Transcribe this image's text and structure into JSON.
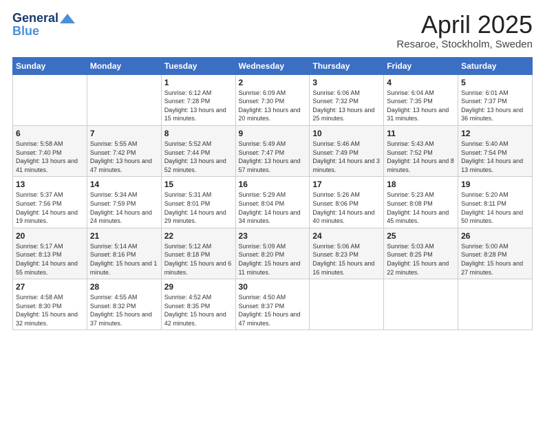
{
  "logo": {
    "general": "General",
    "blue": "Blue"
  },
  "header": {
    "title": "April 2025",
    "subtitle": "Resaroe, Stockholm, Sweden"
  },
  "weekdays": [
    "Sunday",
    "Monday",
    "Tuesday",
    "Wednesday",
    "Thursday",
    "Friday",
    "Saturday"
  ],
  "weeks": [
    [
      {
        "day": "",
        "info": ""
      },
      {
        "day": "",
        "info": ""
      },
      {
        "day": "1",
        "info": "Sunrise: 6:12 AM\nSunset: 7:28 PM\nDaylight: 13 hours and 15 minutes."
      },
      {
        "day": "2",
        "info": "Sunrise: 6:09 AM\nSunset: 7:30 PM\nDaylight: 13 hours and 20 minutes."
      },
      {
        "day": "3",
        "info": "Sunrise: 6:06 AM\nSunset: 7:32 PM\nDaylight: 13 hours and 25 minutes."
      },
      {
        "day": "4",
        "info": "Sunrise: 6:04 AM\nSunset: 7:35 PM\nDaylight: 13 hours and 31 minutes."
      },
      {
        "day": "5",
        "info": "Sunrise: 6:01 AM\nSunset: 7:37 PM\nDaylight: 13 hours and 36 minutes."
      }
    ],
    [
      {
        "day": "6",
        "info": "Sunrise: 5:58 AM\nSunset: 7:40 PM\nDaylight: 13 hours and 41 minutes."
      },
      {
        "day": "7",
        "info": "Sunrise: 5:55 AM\nSunset: 7:42 PM\nDaylight: 13 hours and 47 minutes."
      },
      {
        "day": "8",
        "info": "Sunrise: 5:52 AM\nSunset: 7:44 PM\nDaylight: 13 hours and 52 minutes."
      },
      {
        "day": "9",
        "info": "Sunrise: 5:49 AM\nSunset: 7:47 PM\nDaylight: 13 hours and 57 minutes."
      },
      {
        "day": "10",
        "info": "Sunrise: 5:46 AM\nSunset: 7:49 PM\nDaylight: 14 hours and 3 minutes."
      },
      {
        "day": "11",
        "info": "Sunrise: 5:43 AM\nSunset: 7:52 PM\nDaylight: 14 hours and 8 minutes."
      },
      {
        "day": "12",
        "info": "Sunrise: 5:40 AM\nSunset: 7:54 PM\nDaylight: 14 hours and 13 minutes."
      }
    ],
    [
      {
        "day": "13",
        "info": "Sunrise: 5:37 AM\nSunset: 7:56 PM\nDaylight: 14 hours and 19 minutes."
      },
      {
        "day": "14",
        "info": "Sunrise: 5:34 AM\nSunset: 7:59 PM\nDaylight: 14 hours and 24 minutes."
      },
      {
        "day": "15",
        "info": "Sunrise: 5:31 AM\nSunset: 8:01 PM\nDaylight: 14 hours and 29 minutes."
      },
      {
        "day": "16",
        "info": "Sunrise: 5:29 AM\nSunset: 8:04 PM\nDaylight: 14 hours and 34 minutes."
      },
      {
        "day": "17",
        "info": "Sunrise: 5:26 AM\nSunset: 8:06 PM\nDaylight: 14 hours and 40 minutes."
      },
      {
        "day": "18",
        "info": "Sunrise: 5:23 AM\nSunset: 8:08 PM\nDaylight: 14 hours and 45 minutes."
      },
      {
        "day": "19",
        "info": "Sunrise: 5:20 AM\nSunset: 8:11 PM\nDaylight: 14 hours and 50 minutes."
      }
    ],
    [
      {
        "day": "20",
        "info": "Sunrise: 5:17 AM\nSunset: 8:13 PM\nDaylight: 14 hours and 55 minutes."
      },
      {
        "day": "21",
        "info": "Sunrise: 5:14 AM\nSunset: 8:16 PM\nDaylight: 15 hours and 1 minute."
      },
      {
        "day": "22",
        "info": "Sunrise: 5:12 AM\nSunset: 8:18 PM\nDaylight: 15 hours and 6 minutes."
      },
      {
        "day": "23",
        "info": "Sunrise: 5:09 AM\nSunset: 8:20 PM\nDaylight: 15 hours and 11 minutes."
      },
      {
        "day": "24",
        "info": "Sunrise: 5:06 AM\nSunset: 8:23 PM\nDaylight: 15 hours and 16 minutes."
      },
      {
        "day": "25",
        "info": "Sunrise: 5:03 AM\nSunset: 8:25 PM\nDaylight: 15 hours and 22 minutes."
      },
      {
        "day": "26",
        "info": "Sunrise: 5:00 AM\nSunset: 8:28 PM\nDaylight: 15 hours and 27 minutes."
      }
    ],
    [
      {
        "day": "27",
        "info": "Sunrise: 4:58 AM\nSunset: 8:30 PM\nDaylight: 15 hours and 32 minutes."
      },
      {
        "day": "28",
        "info": "Sunrise: 4:55 AM\nSunset: 8:32 PM\nDaylight: 15 hours and 37 minutes."
      },
      {
        "day": "29",
        "info": "Sunrise: 4:52 AM\nSunset: 8:35 PM\nDaylight: 15 hours and 42 minutes."
      },
      {
        "day": "30",
        "info": "Sunrise: 4:50 AM\nSunset: 8:37 PM\nDaylight: 15 hours and 47 minutes."
      },
      {
        "day": "",
        "info": ""
      },
      {
        "day": "",
        "info": ""
      },
      {
        "day": "",
        "info": ""
      }
    ]
  ]
}
